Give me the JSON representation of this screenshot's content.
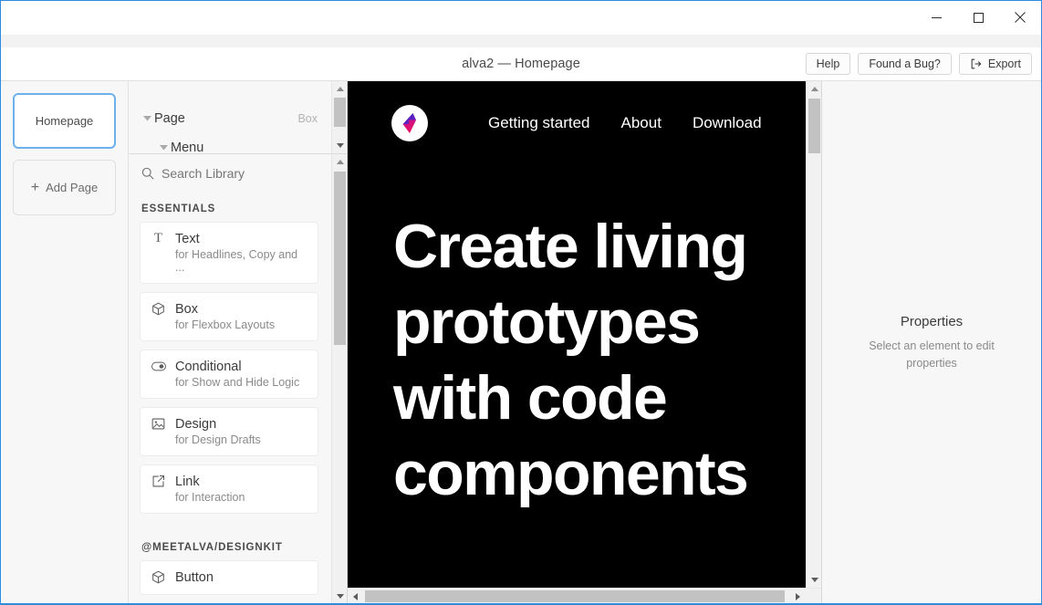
{
  "window": {
    "minimize_label": "Minimize",
    "maximize_label": "Maximize",
    "close_label": "Close"
  },
  "chrome": {
    "title": "alva2 — Homepage",
    "help_label": "Help",
    "bug_label": "Found a Bug?",
    "export_label": "Export"
  },
  "pages": {
    "current_page_label": "Homepage",
    "add_page_label": "Add Page",
    "add_icon": "plus-icon"
  },
  "element_tree": {
    "rows": [
      {
        "name": "Page",
        "type": "Box",
        "indent": 0,
        "expanded": true
      },
      {
        "name": "Menu",
        "type": "",
        "indent": 1,
        "expanded": true
      }
    ]
  },
  "library": {
    "search_placeholder": "Search Library",
    "search_icon": "search-icon",
    "sections": [
      {
        "title": "ESSENTIALS",
        "items": [
          {
            "name": "Text",
            "desc": "for Headlines, Copy and ...",
            "icon": "text-icon"
          },
          {
            "name": "Box",
            "desc": "for Flexbox Layouts",
            "icon": "cube-icon"
          },
          {
            "name": "Conditional",
            "desc": "for Show and Hide Logic",
            "icon": "toggle-icon"
          },
          {
            "name": "Design",
            "desc": "for Design Drafts",
            "icon": "image-icon"
          },
          {
            "name": "Link",
            "desc": "for Interaction",
            "icon": "external-link-icon"
          }
        ]
      },
      {
        "title": "@MEETALVA/DESIGNKIT",
        "items": [
          {
            "name": "Button",
            "desc": "",
            "icon": "cube-icon"
          }
        ]
      }
    ]
  },
  "preview": {
    "background_color": "#000000",
    "logo_name": "alva-lightning-logo",
    "logo_colors": {
      "top": "#3d2bd6",
      "bottom": "#e8147f"
    },
    "nav_links": [
      "Getting started",
      "About",
      "Download"
    ],
    "headline": "Create living prototypes with code components"
  },
  "properties": {
    "title": "Properties",
    "hint": "Select an element to edit properties"
  }
}
